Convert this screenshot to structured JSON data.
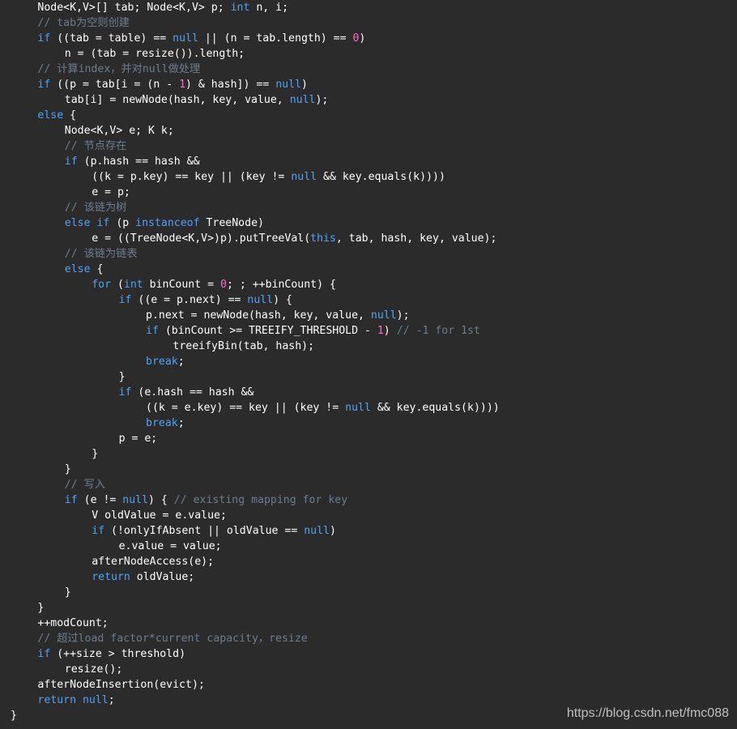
{
  "colors": {
    "background": "#2b2b2b",
    "plain": "#ffffff",
    "keyword": "#4fa3f3",
    "comment": "#6d7d8f",
    "number": "#ff6abf"
  },
  "code": {
    "lines": [
      {
        "indent": 1,
        "tokens": [
          {
            "t": "plain",
            "v": "Node<K,V>[] tab; Node<K,V> p; "
          },
          {
            "t": "kw",
            "v": "int"
          },
          {
            "t": "plain",
            "v": " n, i;"
          }
        ]
      },
      {
        "indent": 1,
        "tokens": [
          {
            "t": "cm",
            "v": "// tab为空则创建"
          }
        ]
      },
      {
        "indent": 1,
        "tokens": [
          {
            "t": "kw",
            "v": "if"
          },
          {
            "t": "plain",
            "v": " ((tab = table) == "
          },
          {
            "t": "kw",
            "v": "null"
          },
          {
            "t": "plain",
            "v": " || (n = tab.length) == "
          },
          {
            "t": "num",
            "v": "0"
          },
          {
            "t": "plain",
            "v": ")"
          }
        ]
      },
      {
        "indent": 2,
        "tokens": [
          {
            "t": "plain",
            "v": "n = (tab = resize()).length;"
          }
        ]
      },
      {
        "indent": 1,
        "tokens": [
          {
            "t": "cm",
            "v": "// 计算index，并对null做处理"
          }
        ]
      },
      {
        "indent": 1,
        "tokens": [
          {
            "t": "kw",
            "v": "if"
          },
          {
            "t": "plain",
            "v": " ((p = tab[i = (n - "
          },
          {
            "t": "num",
            "v": "1"
          },
          {
            "t": "plain",
            "v": ") & hash]) == "
          },
          {
            "t": "kw",
            "v": "null"
          },
          {
            "t": "plain",
            "v": ")"
          }
        ]
      },
      {
        "indent": 2,
        "tokens": [
          {
            "t": "plain",
            "v": "tab[i] = newNode(hash, key, value, "
          },
          {
            "t": "kw",
            "v": "null"
          },
          {
            "t": "plain",
            "v": ");"
          }
        ]
      },
      {
        "indent": 1,
        "tokens": [
          {
            "t": "kw",
            "v": "else"
          },
          {
            "t": "plain",
            "v": " {"
          }
        ]
      },
      {
        "indent": 2,
        "tokens": [
          {
            "t": "plain",
            "v": "Node<K,V> e; K k;"
          }
        ]
      },
      {
        "indent": 2,
        "tokens": [
          {
            "t": "cm",
            "v": "// 节点存在"
          }
        ]
      },
      {
        "indent": 2,
        "tokens": [
          {
            "t": "kw",
            "v": "if"
          },
          {
            "t": "plain",
            "v": " (p.hash == hash &&"
          }
        ]
      },
      {
        "indent": 3,
        "tokens": [
          {
            "t": "plain",
            "v": "((k = p.key) == key || (key != "
          },
          {
            "t": "kw",
            "v": "null"
          },
          {
            "t": "plain",
            "v": " && key.equals(k))))"
          }
        ]
      },
      {
        "indent": 3,
        "tokens": [
          {
            "t": "plain",
            "v": "e = p;"
          }
        ]
      },
      {
        "indent": 2,
        "tokens": [
          {
            "t": "cm",
            "v": "// 该链为树"
          }
        ]
      },
      {
        "indent": 2,
        "tokens": [
          {
            "t": "kw",
            "v": "else if"
          },
          {
            "t": "plain",
            "v": " (p "
          },
          {
            "t": "kw",
            "v": "instanceof"
          },
          {
            "t": "plain",
            "v": " TreeNode)"
          }
        ]
      },
      {
        "indent": 3,
        "tokens": [
          {
            "t": "plain",
            "v": "e = ((TreeNode<K,V>)p).putTreeVal("
          },
          {
            "t": "kw",
            "v": "this"
          },
          {
            "t": "plain",
            "v": ", tab, hash, key, value);"
          }
        ]
      },
      {
        "indent": 2,
        "tokens": [
          {
            "t": "cm",
            "v": "// 该链为链表"
          }
        ]
      },
      {
        "indent": 2,
        "tokens": [
          {
            "t": "kw",
            "v": "else"
          },
          {
            "t": "plain",
            "v": " {"
          }
        ]
      },
      {
        "indent": 3,
        "tokens": [
          {
            "t": "kw",
            "v": "for"
          },
          {
            "t": "plain",
            "v": " ("
          },
          {
            "t": "kw",
            "v": "int"
          },
          {
            "t": "plain",
            "v": " binCount = "
          },
          {
            "t": "num",
            "v": "0"
          },
          {
            "t": "plain",
            "v": "; ; ++binCount) {"
          }
        ]
      },
      {
        "indent": 4,
        "tokens": [
          {
            "t": "kw",
            "v": "if"
          },
          {
            "t": "plain",
            "v": " ((e = p.next) == "
          },
          {
            "t": "kw",
            "v": "null"
          },
          {
            "t": "plain",
            "v": ") {"
          }
        ]
      },
      {
        "indent": 5,
        "tokens": [
          {
            "t": "plain",
            "v": "p.next = newNode(hash, key, value, "
          },
          {
            "t": "kw",
            "v": "null"
          },
          {
            "t": "plain",
            "v": ");"
          }
        ]
      },
      {
        "indent": 5,
        "tokens": [
          {
            "t": "kw",
            "v": "if"
          },
          {
            "t": "plain",
            "v": " (binCount >= TREEIFY_THRESHOLD - "
          },
          {
            "t": "num",
            "v": "1"
          },
          {
            "t": "plain",
            "v": ") "
          },
          {
            "t": "cm",
            "v": "// -1 for 1st"
          }
        ]
      },
      {
        "indent": 6,
        "tokens": [
          {
            "t": "plain",
            "v": "treeifyBin(tab, hash);"
          }
        ]
      },
      {
        "indent": 5,
        "tokens": [
          {
            "t": "kw",
            "v": "break"
          },
          {
            "t": "plain",
            "v": ";"
          }
        ]
      },
      {
        "indent": 4,
        "tokens": [
          {
            "t": "plain",
            "v": "}"
          }
        ]
      },
      {
        "indent": 4,
        "tokens": [
          {
            "t": "kw",
            "v": "if"
          },
          {
            "t": "plain",
            "v": " (e.hash == hash &&"
          }
        ]
      },
      {
        "indent": 5,
        "tokens": [
          {
            "t": "plain",
            "v": "((k = e.key) == key || (key != "
          },
          {
            "t": "kw",
            "v": "null"
          },
          {
            "t": "plain",
            "v": " && key.equals(k))))"
          }
        ]
      },
      {
        "indent": 5,
        "tokens": [
          {
            "t": "kw",
            "v": "break"
          },
          {
            "t": "plain",
            "v": ";"
          }
        ]
      },
      {
        "indent": 4,
        "tokens": [
          {
            "t": "plain",
            "v": "p = e;"
          }
        ]
      },
      {
        "indent": 3,
        "tokens": [
          {
            "t": "plain",
            "v": "}"
          }
        ]
      },
      {
        "indent": 2,
        "tokens": [
          {
            "t": "plain",
            "v": "}"
          }
        ]
      },
      {
        "indent": 2,
        "tokens": [
          {
            "t": "cm",
            "v": "// 写入"
          }
        ]
      },
      {
        "indent": 2,
        "tokens": [
          {
            "t": "kw",
            "v": "if"
          },
          {
            "t": "plain",
            "v": " (e != "
          },
          {
            "t": "kw",
            "v": "null"
          },
          {
            "t": "plain",
            "v": ") { "
          },
          {
            "t": "cm",
            "v": "// existing mapping for key"
          }
        ]
      },
      {
        "indent": 3,
        "tokens": [
          {
            "t": "plain",
            "v": "V oldValue = e.value;"
          }
        ]
      },
      {
        "indent": 3,
        "tokens": [
          {
            "t": "kw",
            "v": "if"
          },
          {
            "t": "plain",
            "v": " (!onlyIfAbsent || oldValue == "
          },
          {
            "t": "kw",
            "v": "null"
          },
          {
            "t": "plain",
            "v": ")"
          }
        ]
      },
      {
        "indent": 4,
        "tokens": [
          {
            "t": "plain",
            "v": "e.value = value;"
          }
        ]
      },
      {
        "indent": 3,
        "tokens": [
          {
            "t": "plain",
            "v": "afterNodeAccess(e);"
          }
        ]
      },
      {
        "indent": 3,
        "tokens": [
          {
            "t": "kw",
            "v": "return"
          },
          {
            "t": "plain",
            "v": " oldValue;"
          }
        ]
      },
      {
        "indent": 2,
        "tokens": [
          {
            "t": "plain",
            "v": "}"
          }
        ]
      },
      {
        "indent": 1,
        "tokens": [
          {
            "t": "plain",
            "v": "}"
          }
        ]
      },
      {
        "indent": 1,
        "tokens": [
          {
            "t": "plain",
            "v": "++modCount;"
          }
        ]
      },
      {
        "indent": 1,
        "tokens": [
          {
            "t": "cm",
            "v": "// 超过load factor*current capacity，resize"
          }
        ]
      },
      {
        "indent": 1,
        "tokens": [
          {
            "t": "kw",
            "v": "if"
          },
          {
            "t": "plain",
            "v": " (++size > threshold)"
          }
        ]
      },
      {
        "indent": 2,
        "tokens": [
          {
            "t": "plain",
            "v": "resize();"
          }
        ]
      },
      {
        "indent": 1,
        "tokens": [
          {
            "t": "plain",
            "v": "afterNodeInsertion(evict);"
          }
        ]
      },
      {
        "indent": 1,
        "tokens": [
          {
            "t": "kw",
            "v": "return"
          },
          {
            "t": "plain",
            "v": " "
          },
          {
            "t": "kw",
            "v": "null"
          },
          {
            "t": "plain",
            "v": ";"
          }
        ]
      },
      {
        "indent": 0,
        "tokens": [
          {
            "t": "plain",
            "v": "}"
          }
        ]
      }
    ]
  },
  "watermark": {
    "text": "https://blog.csdn.net/fmc088"
  }
}
